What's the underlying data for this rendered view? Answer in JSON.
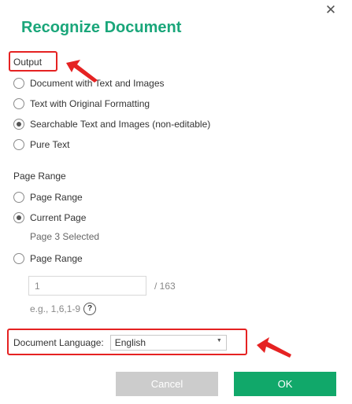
{
  "dialog": {
    "title": "Recognize Document",
    "close_glyph": "✕"
  },
  "output": {
    "label": "Output",
    "options": [
      {
        "label": "Document with Text and Images",
        "checked": false
      },
      {
        "label": "Text with Original Formatting",
        "checked": false
      },
      {
        "label": "Searchable Text and Images (non-editable)",
        "checked": true
      },
      {
        "label": "Pure Text",
        "checked": false
      }
    ]
  },
  "page_range": {
    "label": "Page Range",
    "options": [
      {
        "label": "Page Range",
        "checked": false
      },
      {
        "label": "Current Page",
        "checked": true
      },
      {
        "label": "Page Range",
        "checked": false
      }
    ],
    "current_page_hint": "Page 3 Selected",
    "input_value": "1",
    "total": "/ 163",
    "example": "e.g., 1,6,1-9",
    "help_glyph": "?"
  },
  "language": {
    "label": "Document Language:",
    "selected": "English",
    "caret_glyph": "▼"
  },
  "buttons": {
    "cancel": "Cancel",
    "ok": "OK"
  },
  "colors": {
    "title": "#1aa67a",
    "ok_button": "#11a86a",
    "cancel_button": "#cccccc",
    "annotation": "#e52222"
  }
}
